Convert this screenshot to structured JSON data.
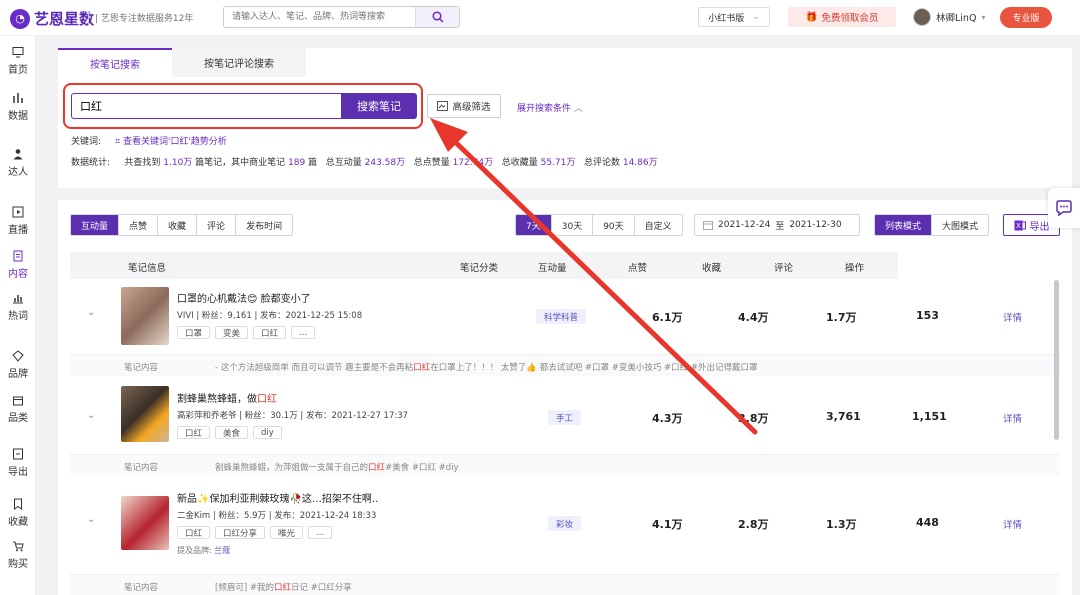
{
  "app": {
    "logo_text": "艺恩星数",
    "slogan": "| 艺恩专注数据服务12年",
    "search_placeholder": "请输入达人、笔记、品牌、热词等搜索",
    "platform_label": "小红书版",
    "free_member": "免费领取会员",
    "username": "林卿LinQ",
    "pro_badge": "专业版"
  },
  "sidebar": [
    {
      "label": "首页",
      "icon": "monitor-icon"
    },
    {
      "label": "数据",
      "icon": "bar-chart-icon"
    },
    {
      "label": "达人",
      "icon": "person-icon"
    },
    {
      "label": "直播",
      "icon": "play-icon"
    },
    {
      "label": "内容",
      "icon": "document-icon",
      "active": true
    },
    {
      "label": "热词",
      "icon": "trend-icon"
    },
    {
      "label": "品牌",
      "icon": "diamond-icon"
    },
    {
      "label": "品类",
      "icon": "box-icon"
    },
    {
      "label": "导出",
      "icon": "export-icon"
    },
    {
      "label": "收藏",
      "icon": "bookmark-icon"
    },
    {
      "label": "购买",
      "icon": "cart-icon"
    }
  ],
  "search_panel": {
    "tabs": [
      "按笔记搜索",
      "按笔记评论搜索"
    ],
    "input_value": "口红",
    "search_button": "搜索笔记",
    "advanced_filter": "高级筛选",
    "expand_conditions": "展开搜索条件",
    "keyword_label": "关键词:",
    "keyword_trend_link": "查看关键词'口红'趋势分析",
    "stats_label": "数据统计:",
    "stats": {
      "t1": "共查找到",
      "found": "1.10万",
      "t2": "篇笔记，其中商业笔记",
      "commercial": "189",
      "t3": "篇",
      "t4": "总互动量",
      "interactions": "243.58万",
      "t5": "总点赞量",
      "likes": "172.74万",
      "t6": "总收藏量",
      "collections": "55.71万",
      "t7": "总评论数",
      "comments": "14.86万"
    }
  },
  "results": {
    "sort_tabs": [
      "互动量",
      "点赞",
      "收藏",
      "评论",
      "发布时间"
    ],
    "period_tabs": [
      "7天",
      "30天",
      "90天",
      "自定义"
    ],
    "date_start": "2021-12-24",
    "date_sep": "至",
    "date_end": "2021-12-30",
    "view_modes": [
      "列表模式",
      "大图模式"
    ],
    "export": "导出",
    "columns": [
      "笔记信息",
      "笔记分类",
      "互动量",
      "点赞",
      "收藏",
      "评论",
      "操作"
    ],
    "rows": [
      {
        "title": "口罩的心机戴法😊 脸都变小了",
        "meta": "VIVI | 粉丝：9,161 | 发布：2021-12-25 15:08",
        "tags": [
          "口罩",
          "变美",
          "口红",
          "..."
        ],
        "category": "科学科普",
        "interactions": "6.1万",
        "likes": "4.4万",
        "collections": "1.7万",
        "comments": "153",
        "detail": "详情",
        "content_label": "笔记内容",
        "content_text": "- 这个方法超级简单 而且可以调节 趣主要是不会再粘",
        "content_kw": "口红",
        "content_rest": "在口罩上了！！！ 太赞了👍 都去试试吧 #口罩 #变美小技巧 #口红 #外出记得戴口罩"
      },
      {
        "title": "割蜂巢熬蜂蜡，做",
        "title_kw": "口红",
        "meta": "高彩萍和乔老爷 | 粉丝：30.1万 | 发布：2021-12-27 17:37",
        "tags": [
          "口红",
          "美食",
          "diy"
        ],
        "category": "手工",
        "interactions": "4.3万",
        "likes": "3.8万",
        "collections": "3,761",
        "comments": "1,151",
        "detail": "详情",
        "content_label": "笔记内容",
        "content_text": "割蜂巢熬蜂蜡，为萍姐做一支属于自己的",
        "content_kw": "口红",
        "content_rest": "#美食 #口红 #diy"
      },
      {
        "title": "新品✨保加利亚荆棘玫瑰🥀这…招架不住啊..",
        "meta": "二金Kim | 粉丝：5.9万 | 发布：2021-12-24 18:33",
        "tags": [
          "口红",
          "口红分享",
          "唯光",
          "..."
        ],
        "category": "彩妆",
        "interactions": "4.1万",
        "likes": "2.8万",
        "collections": "1.3万",
        "comments": "448",
        "detail": "详情",
        "brand_label": "提及品牌:",
        "brand": "兰蔻",
        "content_label": "笔记内容",
        "content_text": "[频眉可] #我的",
        "content_kw": "口红",
        "content_rest": "日记 #口红分享"
      }
    ]
  },
  "colors": {
    "brand": "#5b2fb0",
    "accent": "#6a2cc8",
    "highlight": "#e8362c"
  }
}
